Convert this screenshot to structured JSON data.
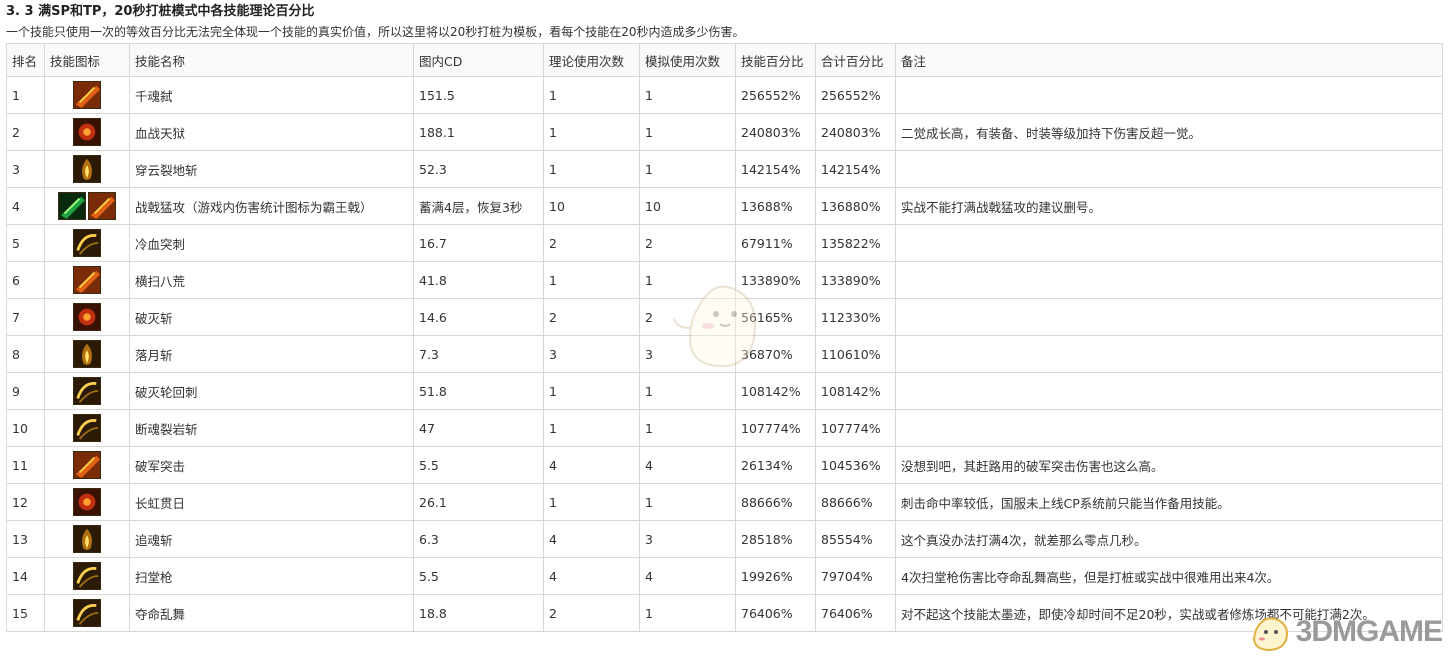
{
  "section": {
    "title": "3. 3  满SP和TP，20秒打桩模式中各技能理论百分比",
    "subtitle": "一个技能只使用一次的等效百分比无法完全体现一个技能的真实价值，所以这里将以20秒打桩为模板，看每个技能在20秒内造成多少伤害。"
  },
  "table": {
    "headers": [
      "排名",
      "技能图标",
      "技能名称",
      "图内CD",
      "理论使用次数",
      "模拟使用次数",
      "技能百分比",
      "合计百分比",
      "备注"
    ],
    "rows": [
      {
        "rank": "1",
        "icons": [
          "skill-icon"
        ],
        "name": "千魂弑",
        "cd": "151.5",
        "theory": "1",
        "sim": "1",
        "pct": "256552%",
        "total": "256552%",
        "note": ""
      },
      {
        "rank": "2",
        "icons": [
          "skill-icon"
        ],
        "name": "血战天狱",
        "cd": "188.1",
        "theory": "1",
        "sim": "1",
        "pct": "240803%",
        "total": "240803%",
        "note": "二觉成长高，有装备、时装等级加持下伤害反超一觉。"
      },
      {
        "rank": "3",
        "icons": [
          "skill-icon"
        ],
        "name": "穿云裂地斩",
        "cd": "52.3",
        "theory": "1",
        "sim": "1",
        "pct": "142154%",
        "total": "142154%",
        "note": ""
      },
      {
        "rank": "4",
        "icons": [
          "skill-icon",
          "skill-icon"
        ],
        "name": "战戟猛攻（游戏内伤害统计图标为霸王戟）",
        "cd": "蓄满4层，恢复3秒",
        "theory": "10",
        "sim": "10",
        "pct": "13688%",
        "total": "136880%",
        "note": "实战不能打满战戟猛攻的建议删号。"
      },
      {
        "rank": "5",
        "icons": [
          "skill-icon"
        ],
        "name": "冷血突刺",
        "cd": "16.7",
        "theory": "2",
        "sim": "2",
        "pct": "67911%",
        "total": "135822%",
        "note": ""
      },
      {
        "rank": "6",
        "icons": [
          "skill-icon"
        ],
        "name": "横扫八荒",
        "cd": "41.8",
        "theory": "1",
        "sim": "1",
        "pct": "133890%",
        "total": "133890%",
        "note": ""
      },
      {
        "rank": "7",
        "icons": [
          "skill-icon"
        ],
        "name": "破灭斩",
        "cd": "14.6",
        "theory": "2",
        "sim": "2",
        "pct": "56165%",
        "total": "112330%",
        "note": ""
      },
      {
        "rank": "8",
        "icons": [
          "skill-icon"
        ],
        "name": "落月斩",
        "cd": "7.3",
        "theory": "3",
        "sim": "3",
        "pct": "36870%",
        "total": "110610%",
        "note": ""
      },
      {
        "rank": "9",
        "icons": [
          "skill-icon"
        ],
        "name": "破灭轮回刺",
        "cd": "51.8",
        "theory": "1",
        "sim": "1",
        "pct": "108142%",
        "total": "108142%",
        "note": ""
      },
      {
        "rank": "10",
        "icons": [
          "skill-icon"
        ],
        "name": "断魂裂岩斩",
        "cd": "47",
        "theory": "1",
        "sim": "1",
        "pct": "107774%",
        "total": "107774%",
        "note": ""
      },
      {
        "rank": "11",
        "icons": [
          "skill-icon"
        ],
        "name": "破军突击",
        "cd": "5.5",
        "theory": "4",
        "sim": "4",
        "pct": "26134%",
        "total": "104536%",
        "note": "没想到吧，其赶路用的破军突击伤害也这么高。"
      },
      {
        "rank": "12",
        "icons": [
          "skill-icon"
        ],
        "name": "长虹贯日",
        "cd": "26.1",
        "theory": "1",
        "sim": "1",
        "pct": "88666%",
        "total": "88666%",
        "note": "刺击命中率较低，国服未上线CP系统前只能当作备用技能。"
      },
      {
        "rank": "13",
        "icons": [
          "skill-icon"
        ],
        "name": "追魂斩",
        "cd": "6.3",
        "theory": "4",
        "sim": "3",
        "pct": "28518%",
        "total": "85554%",
        "note": "这个真没办法打满4次，就差那么零点几秒。"
      },
      {
        "rank": "14",
        "icons": [
          "skill-icon"
        ],
        "name": "扫堂枪",
        "cd": "5.5",
        "theory": "4",
        "sim": "4",
        "pct": "19926%",
        "total": "79704%",
        "note": "4次扫堂枪伤害比夺命乱舞高些，但是打桩或实战中很难用出来4次。"
      },
      {
        "rank": "15",
        "icons": [
          "skill-icon"
        ],
        "name": "夺命乱舞",
        "cd": "18.8",
        "theory": "2",
        "sim": "1",
        "pct": "76406%",
        "total": "76406%",
        "note": "对不起这个技能太墨迹，即使冷却时间不足20秒，实战或者修炼场都不可能打满2次。"
      }
    ]
  },
  "watermark": {
    "text": "3DMGAME"
  },
  "colors": {
    "icon_dark": "#2a1a06",
    "icon_gold": "#f0b020",
    "icon_green": "#3ac060",
    "border": "#d8d8d8"
  }
}
